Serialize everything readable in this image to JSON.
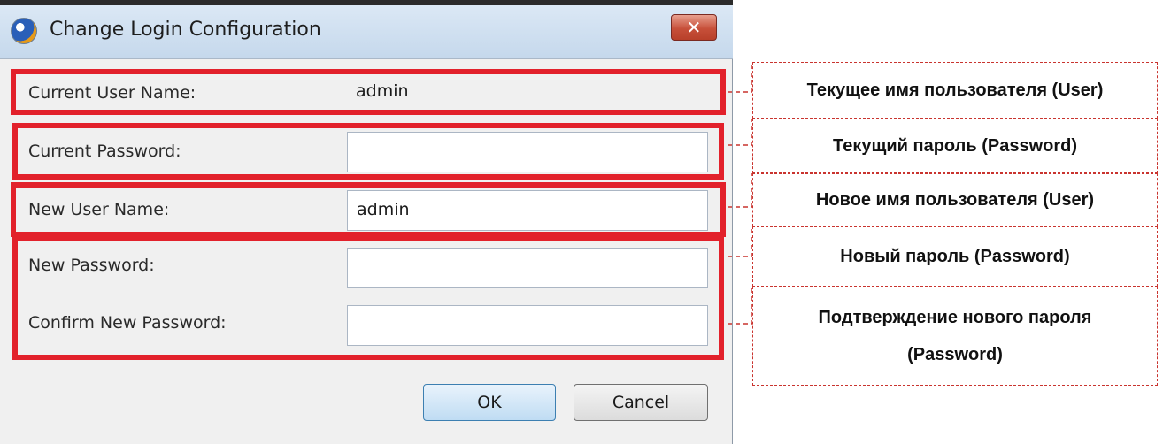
{
  "dialog": {
    "title": "Change Login Configuration",
    "close_label": "✕"
  },
  "fields": {
    "current_user_label": "Current User Name:",
    "current_user_value": "admin",
    "current_password_label": "Current Password:",
    "current_password_value": "",
    "new_user_label": "New User Name:",
    "new_user_value": "admin",
    "new_password_label": "New Password:",
    "new_password_value": "",
    "confirm_password_label": "Confirm New Password:",
    "confirm_password_value": ""
  },
  "buttons": {
    "ok": "OK",
    "cancel": "Cancel"
  },
  "annotations": {
    "current_user": "Текущее имя пользователя (User)",
    "current_password": "Текущий пароль (Password)",
    "new_user": "Новое имя пользователя (User)",
    "new_password": "Новый пароль (Password)",
    "confirm_password_line1": "Подтверждение нового пароля",
    "confirm_password_line2": "(Password)"
  },
  "colors": {
    "highlight": "#e2212b",
    "callout_border": "#c9342f"
  }
}
